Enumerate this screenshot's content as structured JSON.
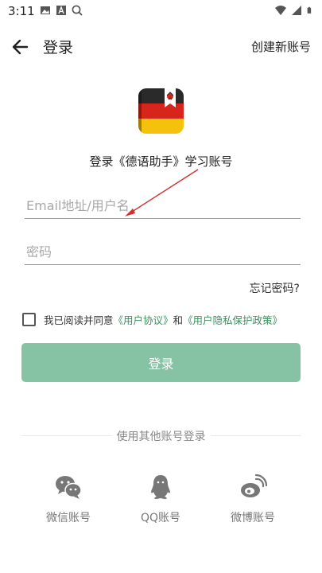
{
  "status_bar": {
    "time": "3:11"
  },
  "header": {
    "title": "登录",
    "create_account": "创建新账号"
  },
  "app_subtitle": "登录《德语助手》学习账号",
  "form": {
    "email_placeholder": "Email地址/用户名",
    "password_placeholder": "密码",
    "forgot_password": "忘记密码?"
  },
  "agreement": {
    "prefix": "我已阅读并同意",
    "user_agreement": "《用户协议》",
    "and": "和",
    "privacy_policy": "《用户隐私保护政策》"
  },
  "login_button": "登录",
  "social": {
    "heading": "使用其他账号登录",
    "items": [
      {
        "label": "微信账号",
        "icon": "wechat-icon"
      },
      {
        "label": "QQ账号",
        "icon": "qq-icon"
      },
      {
        "label": "微博账号",
        "icon": "weibo-icon"
      }
    ]
  },
  "colors": {
    "accent": "#86c2a4",
    "link": "#3a8f5e",
    "annotation_arrow": "#d32f2f"
  }
}
